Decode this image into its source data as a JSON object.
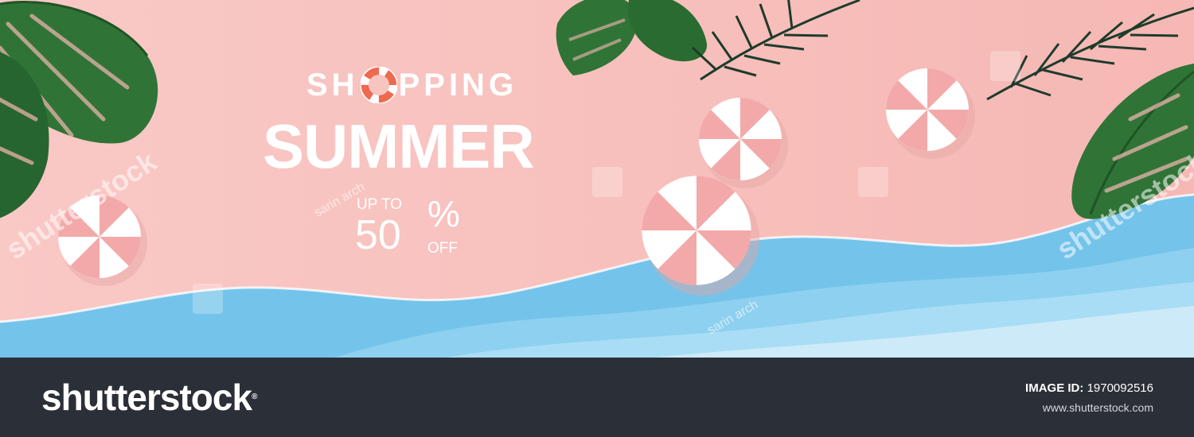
{
  "promo": {
    "shopping_left": "SH",
    "shopping_right": "PPING",
    "headline": "SUMMER",
    "upto": "UP TO",
    "discount": "50",
    "percent": "%",
    "off": "OFF"
  },
  "watermarks": {
    "brand": "shutterstock",
    "author": "sarin arch"
  },
  "footer": {
    "brand": "shutterstock",
    "image_id_label": "IMAGE ID:",
    "image_id": "1970092516",
    "site": "www.shutterstock.com"
  },
  "colors": {
    "sand": "#f8c4c2",
    "sea": "#74c3ea",
    "foam": "#bfe3f6",
    "leaf": "#2e6e33",
    "umbrella_pink": "#f3a9a9",
    "lifebuoy": "#ee6a4f",
    "footer_bg": "#2b2f38"
  }
}
